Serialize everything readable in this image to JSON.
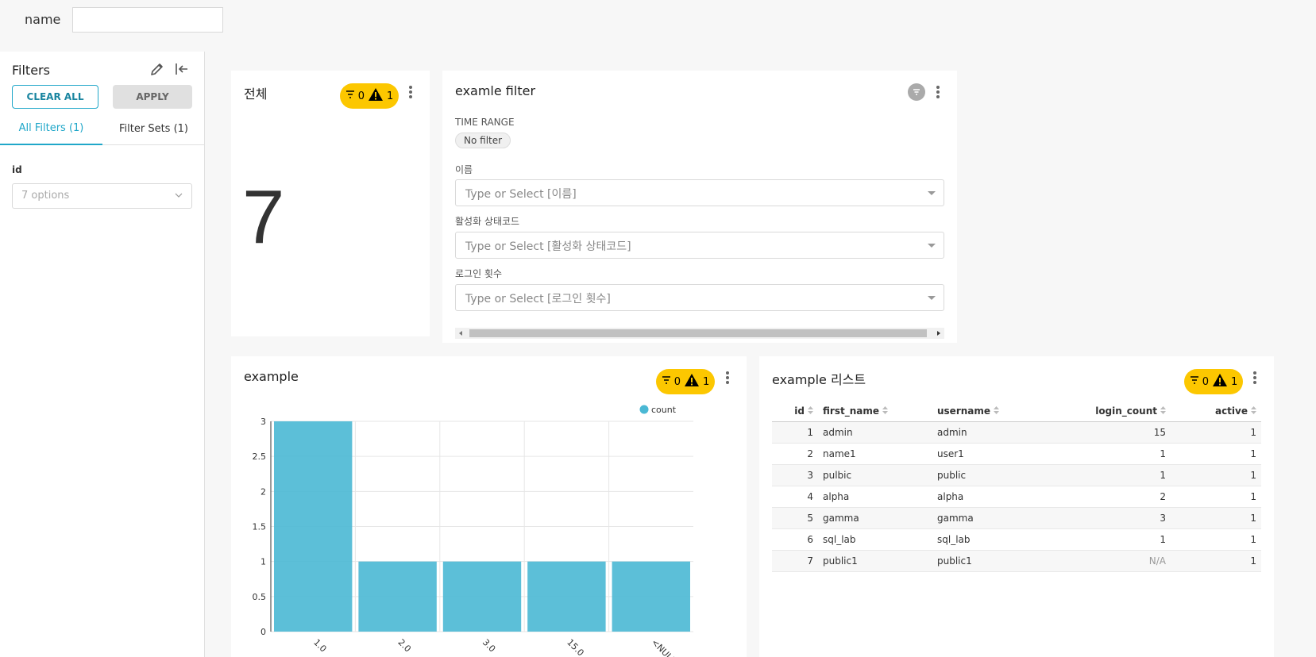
{
  "top": {
    "name_label": "name",
    "name_value": ""
  },
  "sidebar": {
    "title": "Filters",
    "clear_all": "CLEAR ALL",
    "apply": "APPLY",
    "tabs": [
      {
        "label": "All Filters (1)",
        "active": true
      },
      {
        "label": "Filter Sets (1)",
        "active": false
      }
    ],
    "filter": {
      "label": "id",
      "placeholder": "7 options"
    }
  },
  "badge": {
    "filters": "0",
    "warnings": "1"
  },
  "big_number_card": {
    "title": "전체",
    "value": "7"
  },
  "filter_card": {
    "title": "examle filter",
    "time_range_label": "TIME RANGE",
    "time_range_value": "No filter",
    "fields": [
      {
        "label": "이름",
        "placeholder": "Type or Select [이름]"
      },
      {
        "label": "활성화 상태코드",
        "placeholder": "Type or Select [활성화 상태코드]"
      },
      {
        "label": "로그인 횟수",
        "placeholder": "Type or Select [로그인 횟수]"
      }
    ]
  },
  "chart_card": {
    "title": "example",
    "legend": "count"
  },
  "chart_data": {
    "type": "bar",
    "categories": [
      "1.0",
      "2.0",
      "3.0",
      "15.0",
      "<NULL>"
    ],
    "series": [
      {
        "name": "count",
        "values": [
          3,
          1,
          1,
          1,
          1
        ]
      }
    ],
    "ylim": [
      0,
      3
    ],
    "yticks": [
      "0",
      "0.5",
      "1",
      "1.5",
      "2",
      "2.5",
      "3"
    ],
    "color": "#4ab8d4",
    "grid": true,
    "legend_position": "top-right"
  },
  "table_card": {
    "title": "example 리스트",
    "columns": [
      "id",
      "first_name",
      "username",
      "login_count",
      "active"
    ],
    "rows": [
      [
        "1",
        "admin",
        "admin",
        "15",
        "1"
      ],
      [
        "2",
        "name1",
        "user1",
        "1",
        "1"
      ],
      [
        "3",
        "pulbic",
        "public",
        "1",
        "1"
      ],
      [
        "4",
        "alpha",
        "alpha",
        "2",
        "1"
      ],
      [
        "5",
        "gamma",
        "gamma",
        "3",
        "1"
      ],
      [
        "6",
        "sql_lab",
        "sql_lab",
        "1",
        "1"
      ],
      [
        "7",
        "public1",
        "public1",
        "N/A",
        "1"
      ]
    ]
  }
}
